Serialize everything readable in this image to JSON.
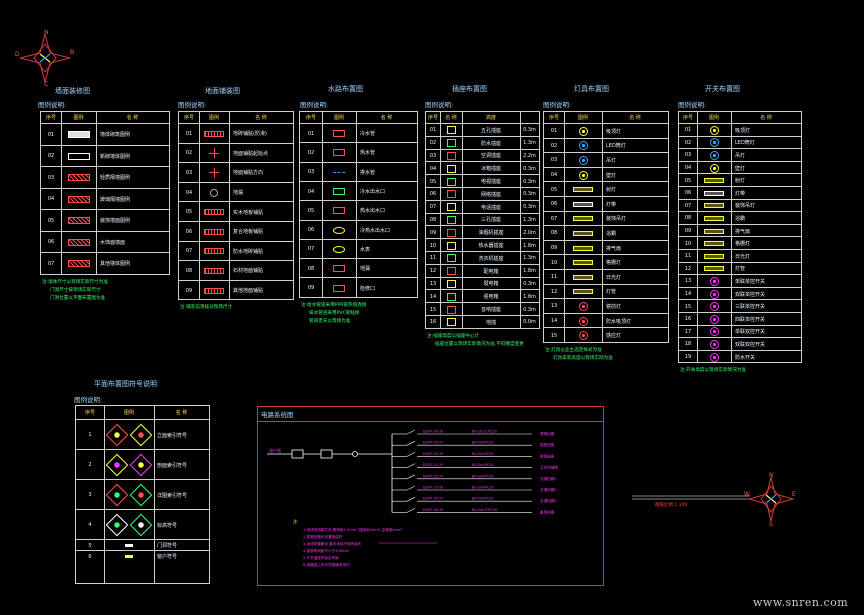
{
  "panels": [
    {
      "title": "墙面装修图",
      "legend": "图例说明:",
      "header": [
        "序号",
        "图例",
        "名 称"
      ],
      "rows": [
        [
          "01",
          "",
          "墙体砌筑图例"
        ],
        [
          "02",
          "",
          "新砌墙体图例"
        ],
        [
          "03",
          "",
          "轻质隔墙图例"
        ],
        [
          "04",
          "",
          "玻璃隔墙图例"
        ],
        [
          "05",
          "",
          "装饰墙面图例"
        ],
        [
          "06",
          "",
          "木饰面墙面"
        ],
        [
          "07",
          "",
          "其他墙体图例"
        ]
      ],
      "notes": [
        "注:墙体尺寸以现场实际尺寸为准",
        "门洞尺寸按现场实际尺寸",
        "门洞位置以平面布置图为准"
      ]
    },
    {
      "title": "地面铺装图",
      "legend": "图例说明:",
      "header": [
        "序号",
        "图例",
        "名 称"
      ],
      "rows": [
        [
          "01",
          "",
          "地砖铺贴(防滑)"
        ],
        [
          "02",
          "",
          "地面铺贴起始点"
        ],
        [
          "03",
          "",
          "地面铺贴方向"
        ],
        [
          "04",
          "",
          "地漏"
        ],
        [
          "05",
          "",
          "实木地板铺贴"
        ],
        [
          "06",
          "",
          "复合地板铺贴"
        ],
        [
          "07",
          "",
          "防水地砖铺贴"
        ],
        [
          "08",
          "",
          "石材地面铺贴"
        ],
        [
          "09",
          "",
          "其他地面铺贴"
        ]
      ],
      "notes": [
        "注:铺装前须核对现场尺寸"
      ]
    },
    {
      "title": "水路布置图",
      "legend": "图例说明:",
      "header": [
        "序号",
        "图例",
        "名 称"
      ],
      "rows": [
        [
          "01",
          "",
          "冷水管"
        ],
        [
          "02",
          "",
          "热水管"
        ],
        [
          "03",
          "",
          "排水管"
        ],
        [
          "04",
          "",
          "冷水出水口"
        ],
        [
          "05",
          "",
          "热水出水口"
        ],
        [
          "06",
          "",
          "冷热水出水口"
        ],
        [
          "07",
          "",
          "水表"
        ],
        [
          "08",
          "",
          "地漏"
        ],
        [
          "09",
          "",
          "检修口"
        ]
      ],
      "notes": [
        "注:给水管道采用PPR管热熔连接",
        "排水管道采用PVC管粘接",
        "管道走向以现场为准"
      ]
    },
    {
      "title": "插座布置图",
      "legend": "图例说明:",
      "header": [
        "序号",
        "名 称",
        "高度"
      ],
      "rows": [
        [
          "01",
          "五孔插座",
          "0.3m"
        ],
        [
          "02",
          "防水插座",
          "1.3m"
        ],
        [
          "03",
          "空调插座",
          "2.2m"
        ],
        [
          "04",
          "冰箱插座",
          "0.3m"
        ],
        [
          "05",
          "电视插座",
          "0.3m"
        ],
        [
          "06",
          "网络插座",
          "0.3m"
        ],
        [
          "07",
          "电话插座",
          "0.3m"
        ],
        [
          "08",
          "三孔插座",
          "1.3m"
        ],
        [
          "09",
          "油烟机插座",
          "2.0m"
        ],
        [
          "10",
          "热水器插座",
          "1.8m"
        ],
        [
          "11",
          "洗衣机插座",
          "1.3m"
        ],
        [
          "12",
          "配电箱",
          "1.8m"
        ],
        [
          "13",
          "弱电箱",
          "0.3m"
        ],
        [
          "14",
          "强电箱",
          "1.8m"
        ],
        [
          "15",
          "音响插座",
          "0.3m"
        ],
        [
          "16",
          "地插",
          "0.0m"
        ]
      ],
      "notes": [
        "注:插座高度以插座中心计",
        "插座位置以现场实际情况为准,不得擅自变更"
      ]
    },
    {
      "title": "灯具布置图",
      "legend": "图例说明:",
      "header": [
        "序号",
        "图例",
        "名 称"
      ],
      "rows": [
        [
          "01",
          "",
          "吸顶灯"
        ],
        [
          "02",
          "",
          "LED筒灯"
        ],
        [
          "03",
          "",
          "吊灯"
        ],
        [
          "04",
          "",
          "壁灯"
        ],
        [
          "05",
          "",
          "射灯"
        ],
        [
          "06",
          "",
          "灯带"
        ],
        [
          "07",
          "",
          "装饰吊灯"
        ],
        [
          "08",
          "",
          "浴霸"
        ],
        [
          "09",
          "",
          "排气扇"
        ],
        [
          "10",
          "",
          "格栅灯"
        ],
        [
          "11",
          "",
          "日光灯"
        ],
        [
          "12",
          "",
          "灯管"
        ],
        [
          "13",
          "",
          "镜前灯"
        ],
        [
          "14",
          "",
          "防水吸顶灯"
        ],
        [
          "15",
          "",
          "感应灯"
        ]
      ],
      "notes": [
        "注:灯具以业主选定样式为准",
        "灯具安装高度以现场实际为准"
      ]
    },
    {
      "title": "开关布置图",
      "legend": "图例说明:",
      "header": [
        "序号",
        "图例",
        "名 称"
      ],
      "rows": [
        [
          "01",
          "",
          "吸顶灯"
        ],
        [
          "02",
          "",
          "LED筒灯"
        ],
        [
          "03",
          "",
          "吊灯"
        ],
        [
          "04",
          "",
          "壁灯"
        ],
        [
          "05",
          "",
          "射灯"
        ],
        [
          "06",
          "",
          "灯带"
        ],
        [
          "07",
          "",
          "装饰吊灯"
        ],
        [
          "08",
          "",
          "浴霸"
        ],
        [
          "09",
          "",
          "排气扇"
        ],
        [
          "10",
          "",
          "格栅灯"
        ],
        [
          "11",
          "",
          "日光灯"
        ],
        [
          "12",
          "",
          "灯管"
        ],
        [
          "13",
          "",
          "单联单控开关"
        ],
        [
          "14",
          "",
          "双联单控开关"
        ],
        [
          "15",
          "",
          "三联单控开关"
        ],
        [
          "16",
          "",
          "四联单控开关"
        ],
        [
          "17",
          "",
          "单联双控开关"
        ],
        [
          "18",
          "",
          "双联双控开关"
        ],
        [
          "19",
          "",
          "防水开关"
        ]
      ],
      "notes": [
        "注:开关高度以现场实际情况为准"
      ]
    }
  ],
  "plan_legend": {
    "title": "平面布置图符号说明",
    "legend": "图例说明:",
    "header": [
      "序号",
      "图例",
      "名 称"
    ],
    "rows": [
      [
        "1",
        "",
        "立面索引符号"
      ],
      [
        "2",
        "",
        "剖面索引符号"
      ],
      [
        "3",
        "",
        "详图索引符号"
      ],
      [
        "4",
        "",
        "标高符号"
      ],
      [
        "5",
        "",
        "门洞符号"
      ],
      [
        "6",
        "",
        "窗户符号"
      ]
    ]
  },
  "circuit": {
    "title": "电路系统图",
    "main_label": "进户线",
    "branches": [
      {
        "cb": "DZ47-16 1P",
        "wire": "BV-2x2.5 PC20",
        "load": "照明回路"
      },
      {
        "cb": "DZ47-20 1P",
        "wire": "BV-3x4 PC20",
        "load": "插座回路"
      },
      {
        "cb": "DZ47-20 1P",
        "wire": "BV-3x4 PC20",
        "load": "厨房插座"
      },
      {
        "cb": "DZ47-20 1P",
        "wire": "BV-3x4 PC20",
        "load": "卫生间插座"
      },
      {
        "cb": "DZ47-25 1P",
        "wire": "BV-3x4 PC20",
        "load": "空调回路1"
      },
      {
        "cb": "DZ47-25 1P",
        "wire": "BV-3x4 PC20",
        "load": "空调回路2"
      },
      {
        "cb": "DZ47-25 1P",
        "wire": "BV-3x4 PC20",
        "load": "空调回路3"
      },
      {
        "cb": "DZ47-16 1P",
        "wire": "BV-2x2.5 PC20",
        "load": "备用回路"
      }
    ],
    "notes_head": "注:",
    "notes": [
      "1.电线采用铜芯线,照明用2.5mm²,插座用4mm²,空调用4mm²",
      "2.插座回路均设漏电保护",
      "3.电线穿管敷设,管内电线不得有接头",
      "4.强弱电间距不小于300mm",
      "5.开关插座安装应牢固",
      "6.电路施工完毕须做通电测试"
    ]
  },
  "scale_bar": {
    "label": "图纸比例 1:100"
  },
  "compass": {
    "n": "N",
    "s": "S",
    "e": "E",
    "w": "W"
  },
  "compass_top": {
    "n": "N",
    "s": "C",
    "e": "B",
    "w": "D"
  },
  "watermark": "www.snren.com",
  "colors": {
    "title": "#9fd3ff",
    "note": "#39ff6e",
    "circuit": "#c83a3a",
    "magenta": "#ff33ff",
    "yellow": "#ffff33"
  }
}
